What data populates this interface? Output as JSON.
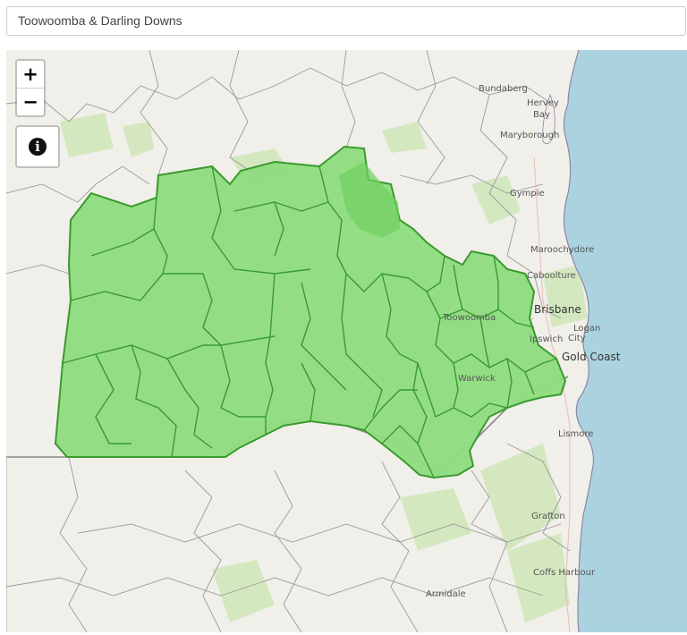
{
  "region_select": {
    "value": "Toowoomba & Darling Downs"
  },
  "map": {
    "zoom_in_label": "+",
    "zoom_out_label": "−",
    "info_label": "i",
    "highlight_color": "#8ddc7f",
    "highlight_border": "#3a9a2e",
    "water_color": "#aad3df",
    "land_color": "#f1efe9",
    "places": [
      {
        "name": "Bundaberg"
      },
      {
        "name": "Hervey"
      },
      {
        "name": "Bay"
      },
      {
        "name": "Maryborough"
      },
      {
        "name": "Gympie"
      },
      {
        "name": "Maroochydore"
      },
      {
        "name": "Caboolture"
      },
      {
        "name": "Brisbane"
      },
      {
        "name": "Toowoomba"
      },
      {
        "name": "Ipswich"
      },
      {
        "name": "Logan"
      },
      {
        "name": "City"
      },
      {
        "name": "Gold Coast"
      },
      {
        "name": "Warwick"
      },
      {
        "name": "Lismore"
      },
      {
        "name": "Grafton"
      },
      {
        "name": "Coffs Harbour"
      },
      {
        "name": "Armidale"
      }
    ]
  }
}
